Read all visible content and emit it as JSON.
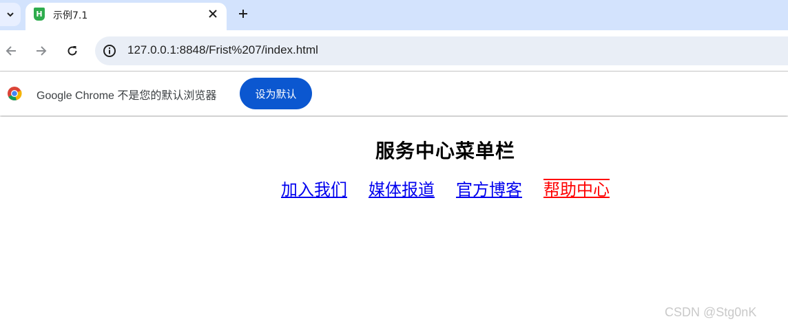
{
  "browser": {
    "tab_title": "示例7.1",
    "tab_favicon": "H",
    "url": "127.0.0.1:8848/Frist%207/index.html"
  },
  "infobar": {
    "message": "Google Chrome 不是您的默认浏览器",
    "button_label": "设为默认"
  },
  "page": {
    "title": "服务中心菜单栏",
    "menu_items": [
      {
        "label": "加入我们"
      },
      {
        "label": "媒体报道"
      },
      {
        "label": "官方博客"
      },
      {
        "label": "帮助中心"
      }
    ]
  },
  "watermark": "CSDN @Stg0nK",
  "colors": {
    "link": "#0000ee",
    "active_link": "#ff0000",
    "primary_button": "#0b57d0",
    "tabstrip": "#d3e3fd"
  }
}
